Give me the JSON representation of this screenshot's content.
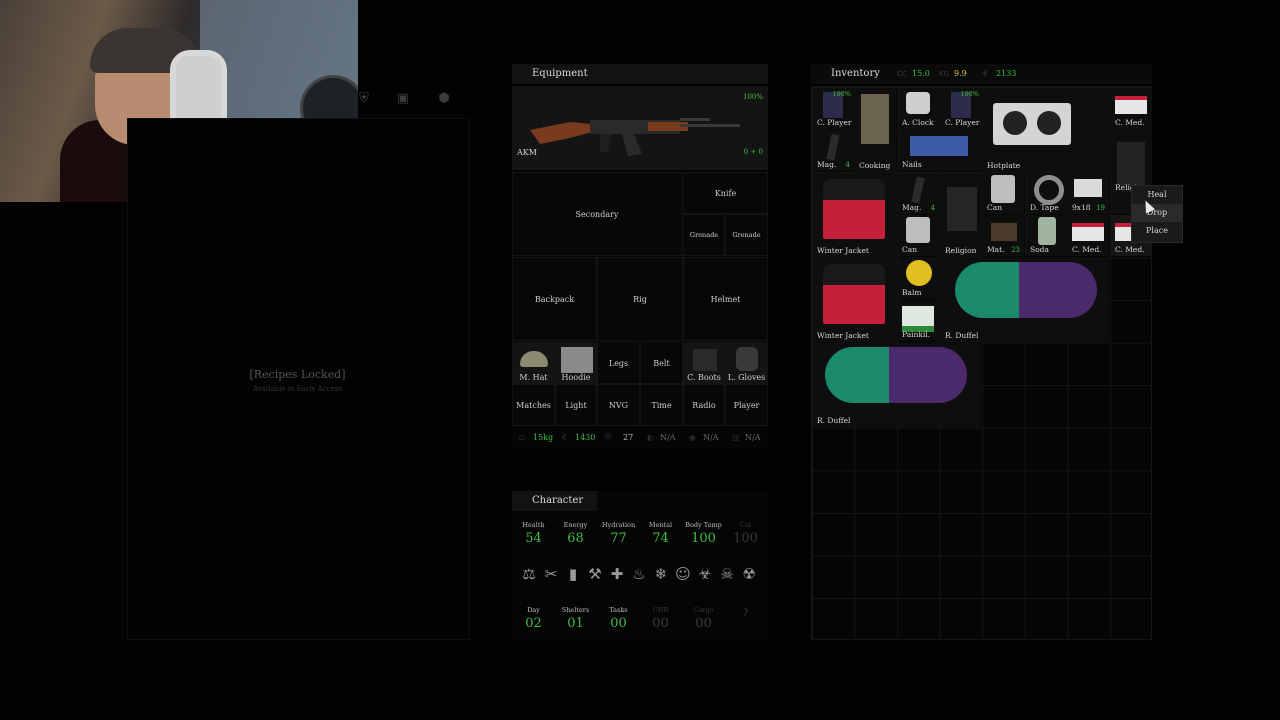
{
  "crafting": {
    "tab_icons": [
      "shield-icon",
      "chip-icon",
      "cube-icon"
    ],
    "locked_text": "[Recipes Locked]",
    "locked_sub": "Available in Early Access"
  },
  "equipment": {
    "title": "Equipment",
    "weapon": {
      "name": "AKM",
      "condition": "100%",
      "ammo": "0 + 0"
    },
    "slots": {
      "secondary": "Secondary",
      "knife": "Knife",
      "grenade1": "Grenade",
      "grenade2": "Grenade",
      "backpack": "Backpack",
      "rig": "Rig",
      "helmet": "Helmet",
      "hat": "M. Hat",
      "top": "Hoodie",
      "legs": "Legs",
      "belt": "Belt",
      "boots": "C. Boots",
      "gloves": "L. Gloves",
      "matches": "Matches",
      "light": "Light",
      "nvg": "NVG",
      "time": "Time",
      "radio": "Radio",
      "player": "Player"
    },
    "stats": {
      "weight": "15kg",
      "value": "1430",
      "armor": "27",
      "s4": "N/A",
      "s5": "N/A",
      "s6": "N/A"
    }
  },
  "character": {
    "title": "Character",
    "stats": [
      {
        "label": "Health",
        "value": "54"
      },
      {
        "label": "Energy",
        "value": "68"
      },
      {
        "label": "Hydration",
        "value": "77"
      },
      {
        "label": "Mental",
        "value": "74"
      },
      {
        "label": "Body Temp",
        "value": "100"
      },
      {
        "label": "Cal",
        "value": "100"
      }
    ],
    "status_icons": [
      "weight-icon",
      "tools-icon",
      "bottle-icon",
      "broken-bone-icon",
      "bleeding-icon",
      "fire-icon",
      "snowflake-icon",
      "demon-icon",
      "biohazard-icon",
      "skull-icon",
      "radiation-icon"
    ],
    "progress": [
      {
        "label": "Day",
        "value": "02"
      },
      {
        "label": "Shelters",
        "value": "01"
      },
      {
        "label": "Tasks",
        "value": "00"
      },
      {
        "label": "CHR",
        "value": "00"
      },
      {
        "label": "Cargo",
        "value": "00"
      },
      {
        "label": "",
        "value": "?"
      }
    ]
  },
  "inventory": {
    "title": "Inventory",
    "header_stats": {
      "capacity": "15.0",
      "weight": "9.9",
      "money": "2133"
    },
    "items": {
      "cplayer1": {
        "name": "C. Player",
        "pct": "100%"
      },
      "cooking": {
        "name": "Cooking"
      },
      "aclock": {
        "name": "A. Clock"
      },
      "cplayer2": {
        "name": "C. Player",
        "pct": "100%"
      },
      "hotplate": {
        "name": "Hotplate"
      },
      "cmed1": {
        "name": "C. Med."
      },
      "mag1": {
        "name": "Mag.",
        "qty": "4"
      },
      "nails": {
        "name": "Nails"
      },
      "religion_top": {
        "name": "Religi"
      },
      "jacket1": {
        "name": "Winter Jacket"
      },
      "mag2": {
        "name": "Mag.",
        "qty": "4"
      },
      "can1": {
        "name": "Can"
      },
      "can2": {
        "name": "Can"
      },
      "religion": {
        "name": "Religion"
      },
      "dtape": {
        "name": "D. Tape"
      },
      "ammo": {
        "name": "9x18",
        "qty": "19"
      },
      "mat": {
        "name": "Mat.",
        "qty": "23"
      },
      "soda": {
        "name": "Soda"
      },
      "cmed2": {
        "name": "C. Med."
      },
      "cmed3": {
        "name": "C. Med."
      },
      "jacket2": {
        "name": "Winter Jacket"
      },
      "balm": {
        "name": "Balm"
      },
      "painkill": {
        "name": "Painkil."
      },
      "duffel1": {
        "name": "R. Duffel"
      },
      "duffel2": {
        "name": "R. Duffel"
      }
    }
  },
  "context_menu": [
    "Heal",
    "Drop",
    "Place"
  ],
  "colors": {
    "accent_green": "#3fbf3f",
    "panel": "#121212",
    "background": "#020202"
  }
}
